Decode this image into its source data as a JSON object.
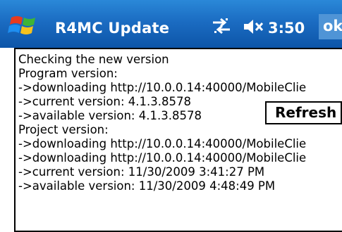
{
  "titlebar": {
    "app_title": "R4MC Update",
    "clock": "3:50",
    "ok_label": "ok"
  },
  "refresh_label": "Refresh",
  "log": {
    "lines": [
      "Checking the new version",
      "Program version:",
      " ->downloading http://10.0.0.14:40000/MobileClie",
      " ->current version: 4.1.3.8578",
      " ->available version: 4.1.3.8578",
      "Project version:",
      " ->downloading http://10.0.0.14:40000/MobileClie",
      " ->downloading http://10.0.0.14:40000/MobileClie",
      " ->current version: 11/30/2009 3:41:27 PM",
      " ->available version: 11/30/2009 4:48:49 PM"
    ]
  },
  "icons": {
    "start": "windows-flag-icon",
    "connectivity": "connectivity-arrows-icon",
    "volume": "speaker-muted-icon"
  },
  "colors": {
    "titlebar_top": "#2a88d8",
    "titlebar_bottom": "#0d55a8",
    "ok_button": "#4f94d6"
  }
}
